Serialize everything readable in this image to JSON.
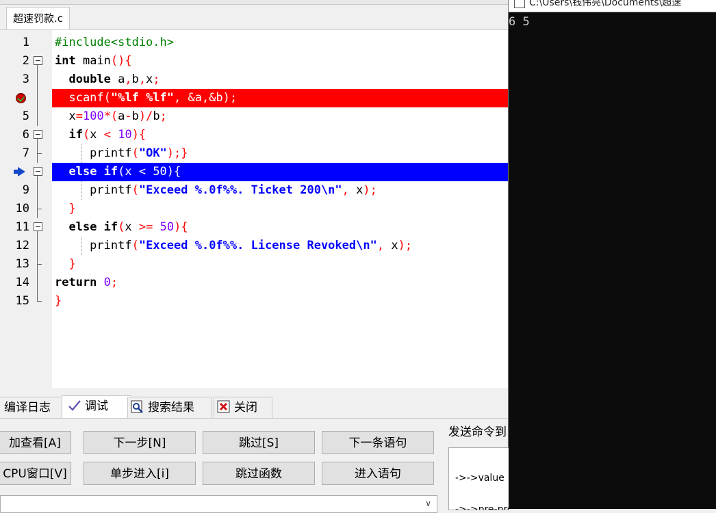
{
  "editor": {
    "file_tab": "超速罚款.c",
    "lines": [
      {
        "n": "1",
        "code": "<span class=\"pp\">#include&lt;stdio.h&gt;</span>",
        "fold": "none",
        "state": ""
      },
      {
        "n": "2",
        "code": "<span class=\"kw\">int</span> main<span class=\"op\">(){</span>",
        "fold": "open",
        "state": ""
      },
      {
        "n": "3",
        "code": "  <span class=\"kw\">double</span> a<span class=\"op\">,</span>b<span class=\"op\">,</span>x<span class=\"op\">;</span>",
        "fold": "line",
        "state": ""
      },
      {
        "n": "4",
        "code": "  scanf(<span class=\"str\">\"%lf %lf\"</span>, &amp;a,&amp;b);",
        "fold": "line",
        "state": "breakpoint"
      },
      {
        "n": "5",
        "code": "  x<span class=\"op\">=</span><span class=\"num\">100</span><span class=\"op\">*(</span>a<span class=\"op\">-</span>b<span class=\"op\">)/</span>b<span class=\"op\">;</span>",
        "fold": "line",
        "state": ""
      },
      {
        "n": "6",
        "code": "  <span class=\"kw\">if</span><span class=\"op\">(</span>x <span class=\"op\">&lt;</span> <span class=\"num\">10</span><span class=\"op\">){</span>",
        "fold": "open",
        "state": ""
      },
      {
        "n": "7",
        "code": "     printf<span class=\"op\">(</span><span class=\"str\">\"OK\"</span><span class=\"op\">);}</span>",
        "fold": "end",
        "state": "",
        "guide": true
      },
      {
        "n": "8",
        "code": "  <span class=\"kw\">else if</span>(x &lt; 50){",
        "fold": "open",
        "state": "current"
      },
      {
        "n": "9",
        "code": "     printf<span class=\"op\">(</span><span class=\"str\">\"Exceed %.0f%%. Ticket 200\\n\"</span><span class=\"op\">,</span> x<span class=\"op\">);</span>",
        "fold": "line",
        "state": "",
        "guide": true
      },
      {
        "n": "10",
        "code": "  <span class=\"op\">}</span>",
        "fold": "end",
        "state": ""
      },
      {
        "n": "11",
        "code": "  <span class=\"kw\">else if</span><span class=\"op\">(</span>x <span class=\"op\">&gt;=</span> <span class=\"num\">50</span><span class=\"op\">){</span>",
        "fold": "open",
        "state": ""
      },
      {
        "n": "12",
        "code": "     printf<span class=\"op\">(</span><span class=\"str\">\"Exceed %.0f%%. License Revoked\\n\"</span><span class=\"op\">,</span> x<span class=\"op\">);</span>",
        "fold": "line",
        "state": "",
        "guide": true
      },
      {
        "n": "13",
        "code": "  <span class=\"op\">}</span>",
        "fold": "end",
        "state": ""
      },
      {
        "n": "14",
        "code": "<span class=\"kw\">return</span> <span class=\"num\">0</span><span class=\"op\">;</span>",
        "fold": "line",
        "state": ""
      },
      {
        "n": "15",
        "code": "<span class=\"op\">}</span>",
        "fold": "last",
        "state": ""
      }
    ],
    "colors": {
      "breakpoint_bg": "#ff0000",
      "current_bg": "#0000ff",
      "string": "#0000ff",
      "number": "#8000ff",
      "operator": "#ff0000",
      "preprocessor": "#008000"
    }
  },
  "console": {
    "title": "C:\\Users\\钱伟亮\\Documents\\超速",
    "output": "6 5"
  },
  "bottom_tabs": [
    {
      "label": "编译日志",
      "icon": "",
      "active": false
    },
    {
      "label": "调试",
      "icon": "checkmark-icon",
      "active": true
    },
    {
      "label": "搜索结果",
      "icon": "search-icon",
      "active": false
    },
    {
      "label": "关闭",
      "icon": "close-icon",
      "active": false
    }
  ],
  "debug": {
    "buttons_row1": [
      "加查看[A]",
      "下一步[N]",
      "跳过[S]",
      "下一条语句"
    ],
    "buttons_row2": [
      "CPU窗口[V]",
      "单步进入[i]",
      "跳过函数",
      "进入语句"
    ],
    "send_command_label": "发送命令到",
    "output_line1": "->->value",
    "output_line2": "->->pre-prompt"
  }
}
